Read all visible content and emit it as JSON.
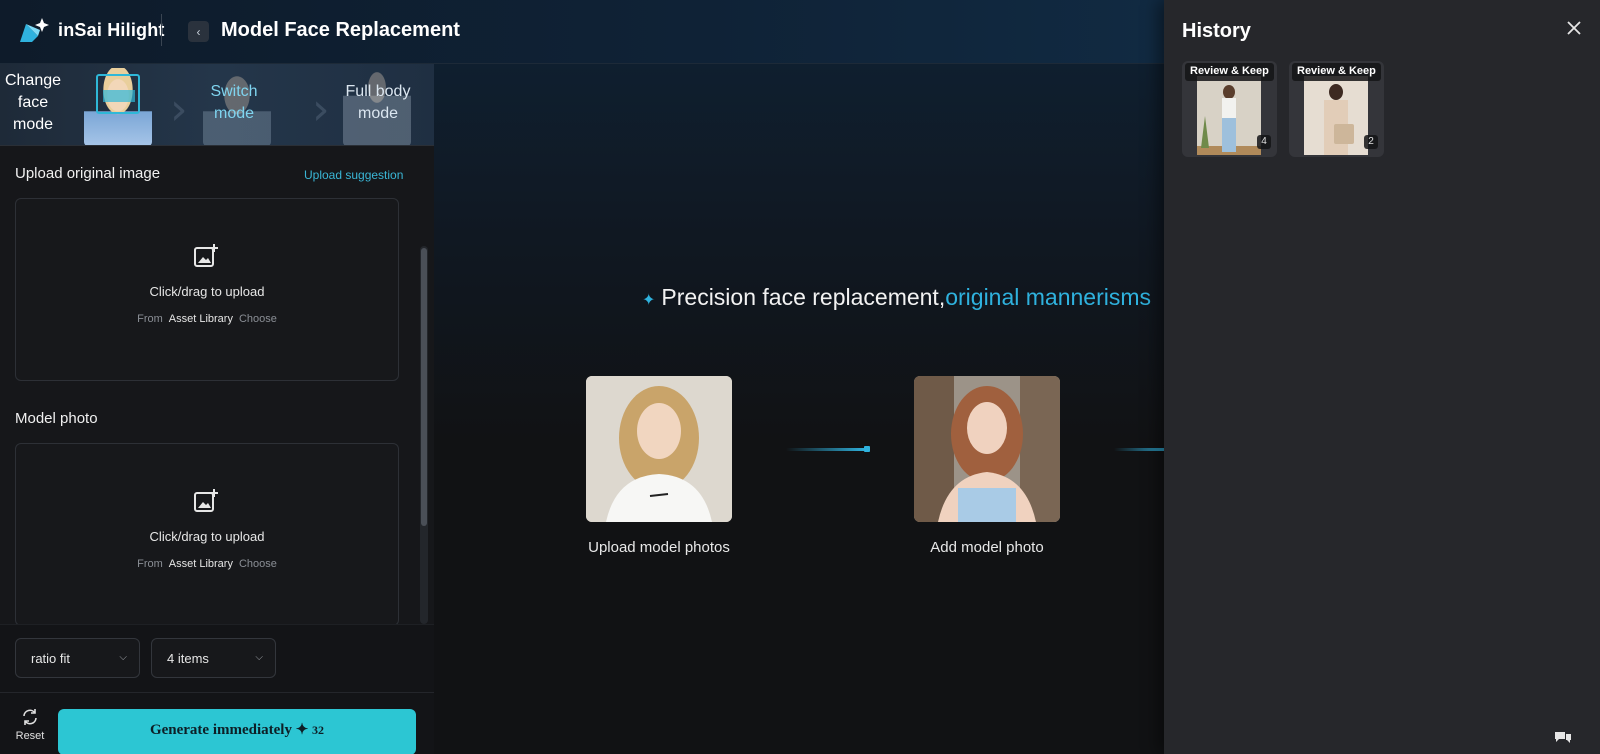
{
  "app": {
    "brand": "inSai Hilight",
    "page_title": "Model Face Replacement"
  },
  "modes": {
    "change_face": "Change face mode",
    "switch": "Switch mode",
    "full_body": "Full body mode"
  },
  "upload_original": {
    "label": "Upload original image",
    "suggestion_link": "Upload suggestion",
    "dropzone_text": "Click/drag to upload",
    "from": "From",
    "asset_library": "Asset Library",
    "choose": "Choose"
  },
  "model_photo": {
    "label": "Model photo",
    "dropzone_text": "Click/drag to upload",
    "from": "From",
    "asset_library": "Asset Library",
    "choose": "Choose"
  },
  "options": {
    "ratio": "ratio fit",
    "count": "4 items"
  },
  "footer": {
    "reset": "Reset",
    "generate": "Generate immediately",
    "cost": "32"
  },
  "main": {
    "headline": "Precision face replacement,",
    "headline_accent": "original mannerisms",
    "steps": [
      {
        "label": "Upload model photos"
      },
      {
        "label": "Add model photo"
      }
    ]
  },
  "history": {
    "title": "History",
    "items": [
      {
        "tag": "Review & Keep",
        "count": "4"
      },
      {
        "tag": "Review & Keep",
        "count": "2"
      }
    ]
  },
  "colors": {
    "accent": "#2fb2de",
    "generate_button": "#2cc6d3",
    "drawer_bg": "#26272b"
  },
  "icons": [
    "logo-icon",
    "back-chevron-icon",
    "image-add-icon",
    "reset-icon",
    "sparkle-icon",
    "close-icon",
    "chat-icon"
  ]
}
